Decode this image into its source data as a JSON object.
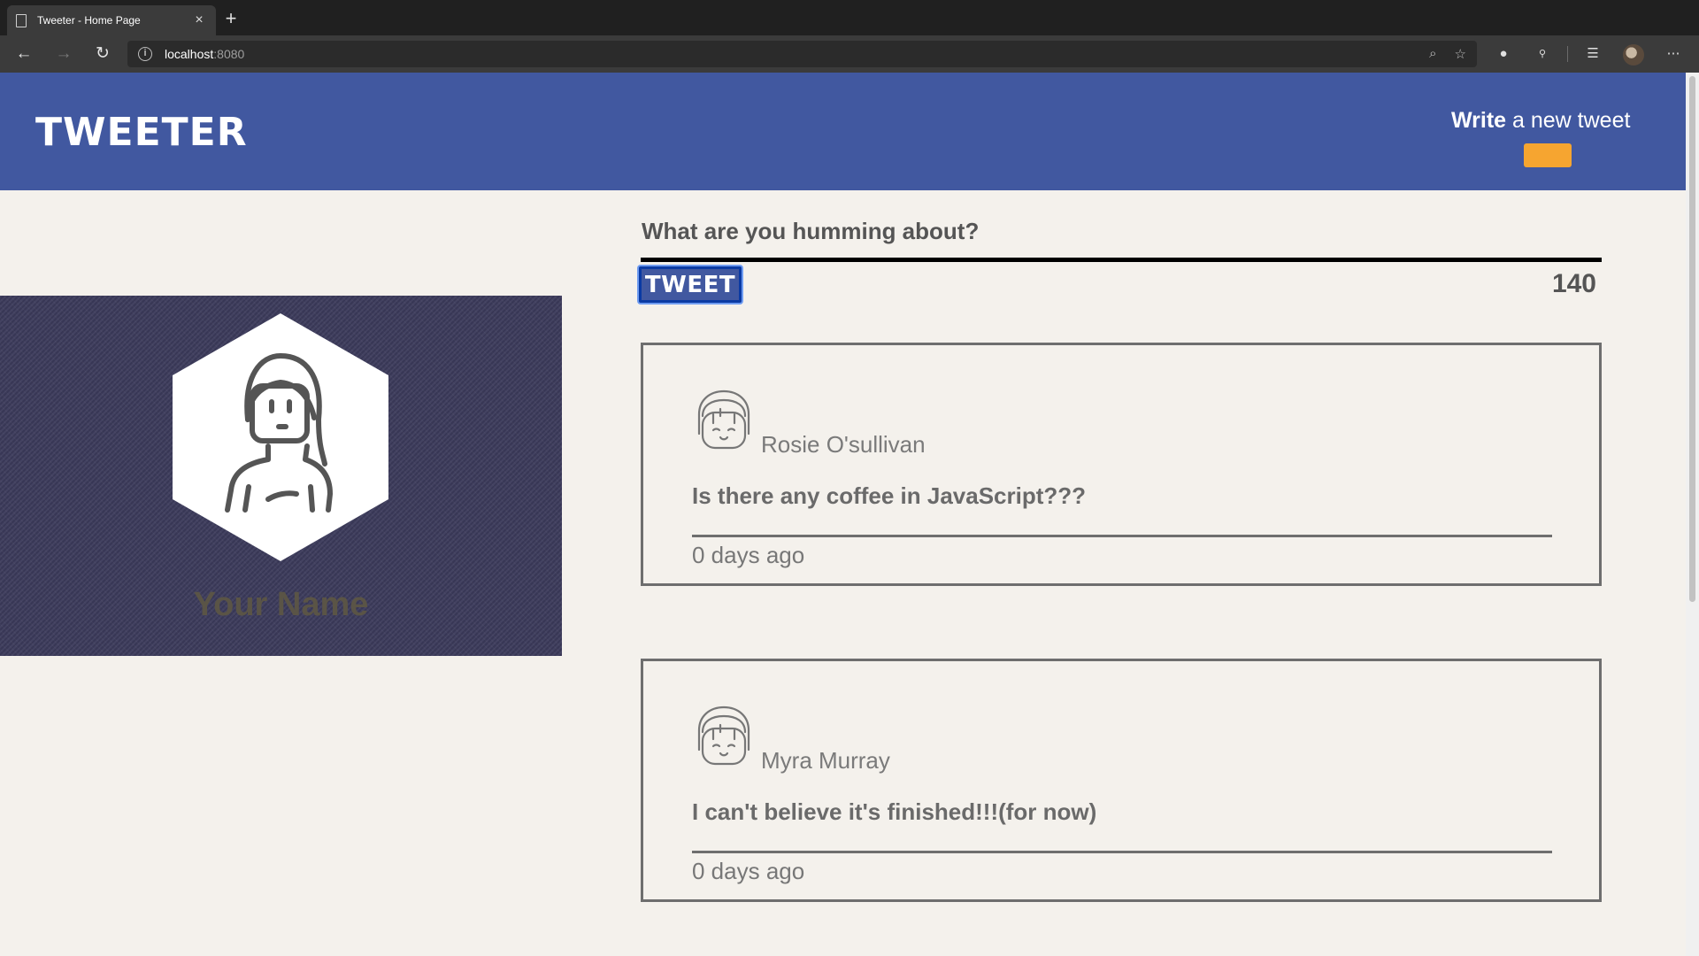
{
  "browser": {
    "tab_title": "Tweeter - Home Page",
    "url_host": "localhost",
    "url_port": ":8080"
  },
  "nav": {
    "brand": "TWEETER",
    "compose_bold": "Write",
    "compose_rest": " a new tweet",
    "toggle_color": "#f6a530"
  },
  "profile": {
    "name": "Your Name"
  },
  "composer": {
    "prompt": "What are you humming about?",
    "submit_label": "TWEET",
    "counter": "140"
  },
  "tweets": [
    {
      "author": "Rosie O'sullivan",
      "content": "Is there any coffee in JavaScript???",
      "timestamp": "0 days ago"
    },
    {
      "author": "Myra Murray",
      "content": "I can't believe it's finished!!!(for now)",
      "timestamp": "0 days ago"
    }
  ],
  "colors": {
    "nav_bg": "#4158a0",
    "page_bg": "#f4f1ec",
    "accent": "#f6a530"
  }
}
